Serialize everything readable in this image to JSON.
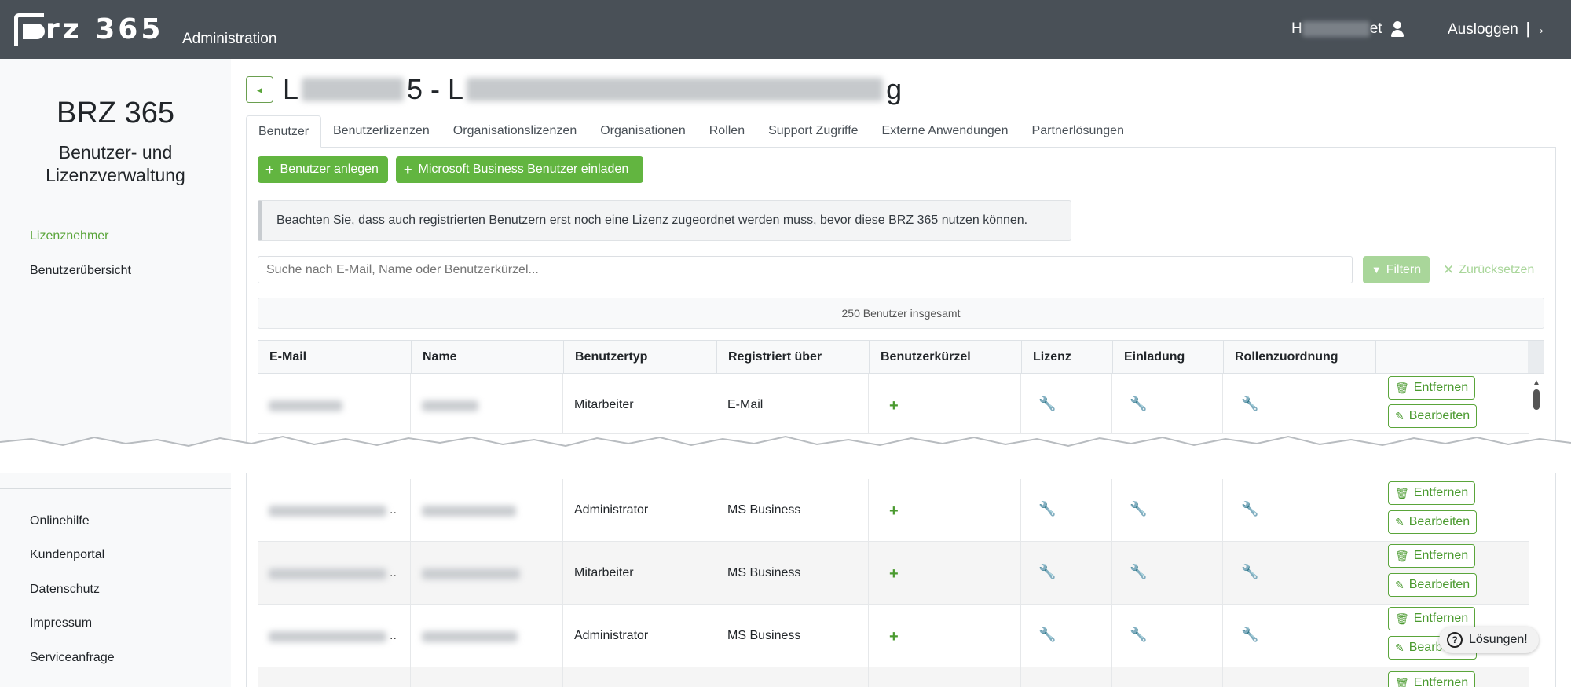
{
  "topbar": {
    "brand": "rz 365",
    "section": "Administration",
    "user_name_visible_start": "H",
    "user_name_visible_end": "et",
    "logout_label": "Ausloggen",
    "background": "#495057"
  },
  "sidebar": {
    "title": "BRZ 365",
    "subtitle_line1": "Benutzer- und",
    "subtitle_line2": "Lizenzverwaltung",
    "nav": [
      {
        "label": "Lizenznehmer",
        "active": true
      },
      {
        "label": "Benutzerübersicht",
        "active": false
      }
    ],
    "footer_links": [
      "Onlinehilfe",
      "Kundenportal",
      "Datenschutz",
      "Impressum",
      "Serviceanfrage"
    ]
  },
  "page": {
    "title_start": "L",
    "title_mid": "5 - L",
    "title_end": "g"
  },
  "tabs": [
    {
      "label": "Benutzer",
      "active": true
    },
    {
      "label": "Benutzerlizenzen",
      "active": false
    },
    {
      "label": "Organisationslizenzen",
      "active": false
    },
    {
      "label": "Organisationen",
      "active": false
    },
    {
      "label": "Rollen",
      "active": false
    },
    {
      "label": "Support Zugriffe",
      "active": false
    },
    {
      "label": "Externe Anwendungen",
      "active": false
    },
    {
      "label": "Partnerlösungen",
      "active": false
    }
  ],
  "actions": {
    "create_user": "Benutzer anlegen",
    "invite_ms": "Microsoft Business Benutzer einladen"
  },
  "alert": "Beachten Sie, dass auch registrierten Benutzern erst noch eine Lizenz zugeordnet werden muss, bevor diese BRZ 365 nutzen können.",
  "search": {
    "placeholder": "Suche nach E-Mail, Name oder Benutzerkürzel...",
    "filter_label": "Filtern",
    "reset_label": "Zurücksetzen"
  },
  "total": "250 Benutzer insgesamt",
  "table": {
    "columns": [
      "E-Mail",
      "Name",
      "Benutzertyp",
      "Registriert über",
      "Benutzerkürzel",
      "Lizenz",
      "Einladung",
      "Rollenzuordnung"
    ],
    "remove_label": "Entfernen",
    "edit_label": "Bearbeiten",
    "rows": [
      {
        "type": "Mitarbeiter",
        "registered": "E-Mail"
      },
      {
        "type": "Administrator",
        "registered": "MS Business"
      },
      {
        "type": "Mitarbeiter",
        "registered": "MS Business"
      },
      {
        "type": "Administrator",
        "registered": "MS Business"
      }
    ]
  },
  "help_pill": "Lösungen!",
  "colors": {
    "accent_green": "#62b540",
    "active_link": "#5aa53a",
    "filter_disabled": "#a9d69a"
  }
}
